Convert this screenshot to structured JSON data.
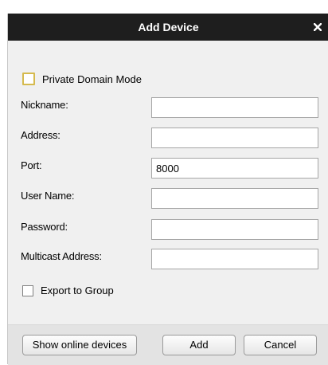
{
  "dialog": {
    "title": "Add Device",
    "close_icon": "close-icon",
    "private_domain_mode": {
      "label": "Private Domain Mode",
      "checked": false
    },
    "fields": {
      "nickname": {
        "label": "Nickname:",
        "value": ""
      },
      "address": {
        "label": "Address:",
        "value": ""
      },
      "port": {
        "label": "Port:",
        "value": "8000"
      },
      "user_name": {
        "label": "User Name:",
        "value": ""
      },
      "password": {
        "label": "Password:",
        "value": ""
      },
      "multicast_address": {
        "label": "Multicast Address:",
        "value": ""
      }
    },
    "export_to_group": {
      "label": "Export to Group",
      "checked": false
    },
    "buttons": {
      "show_online_devices": "Show online devices",
      "add": "Add",
      "cancel": "Cancel"
    }
  }
}
